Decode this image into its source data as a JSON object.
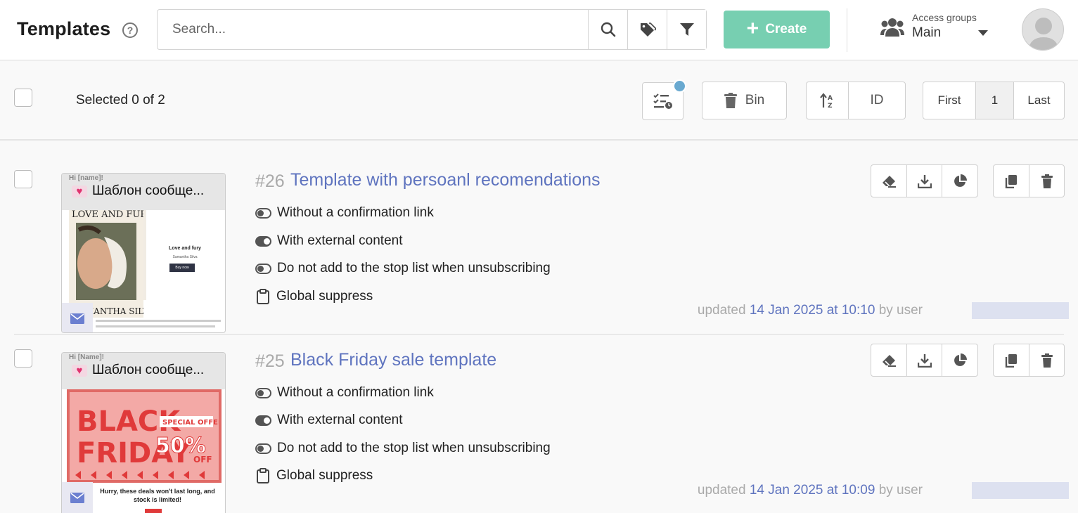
{
  "header": {
    "title": "Templates",
    "help_glyph": "?",
    "search_placeholder": "Search...",
    "create_label": "Create",
    "access_groups_label": "Access groups",
    "access_groups_value": "Main"
  },
  "toolbar": {
    "selected_text": "Selected 0 of 2",
    "bin_label": "Bin",
    "sort_label": "ID",
    "pagination": {
      "first": "First",
      "current": "1",
      "last": "Last"
    }
  },
  "templates": [
    {
      "id": "#26",
      "name": "Template with persoanl recomendations",
      "thumb_caption": "Шаблон сообще...",
      "thumb_greeting": "Hi [name]!",
      "options": [
        {
          "label": "Without a confirmation link",
          "icon": "toggle-off-icon"
        },
        {
          "label": "With external content",
          "icon": "toggle-on-icon"
        },
        {
          "label": "Do not add to the stop list when unsubscribing",
          "icon": "toggle-off-icon"
        },
        {
          "label": "Global suppress",
          "icon": "clipboard-icon"
        }
      ],
      "updated_prefix": "updated",
      "updated_date": "14 Jan 2025 at 10:10",
      "updated_by": "by user",
      "preview": {
        "book_title": "LOVE AND FURY",
        "book_author": "SAMANTHA SILVA",
        "heading": "Love and fury",
        "sub": "Samantha Silva",
        "cta": "Buy now"
      }
    },
    {
      "id": "#25",
      "name": "Black Friday sale template",
      "thumb_caption": "Шаблон сообще...",
      "thumb_greeting": "Hi [Name]!",
      "options": [
        {
          "label": "Without a confirmation link",
          "icon": "toggle-off-icon"
        },
        {
          "label": "With external content",
          "icon": "toggle-on-icon"
        },
        {
          "label": "Do not add to the stop list when unsubscribing",
          "icon": "toggle-off-icon"
        },
        {
          "label": "Global suppress",
          "icon": "clipboard-icon"
        }
      ],
      "updated_prefix": "updated",
      "updated_date": "14 Jan 2025 at 10:09",
      "updated_by": "by user",
      "preview": {
        "line1": "BLACK",
        "line2": "FRIDAY",
        "special": "SPECIAL OFFER",
        "percent": "50%",
        "off": "OFF",
        "footer": "Hurry, these deals won't last long, and stock is limited!"
      }
    }
  ],
  "colors": {
    "accent": "#5f74bf",
    "create": "#77cfb1",
    "badge": "#69a9d0"
  }
}
